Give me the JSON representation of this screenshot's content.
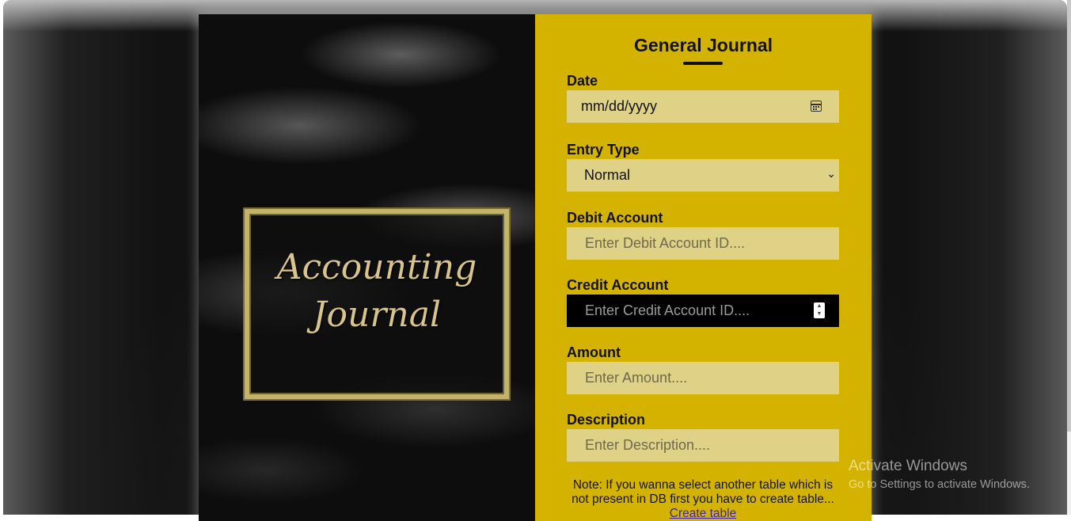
{
  "form": {
    "title": "General Journal",
    "date": {
      "label": "Date",
      "placeholder": "mm/dd/yyyy"
    },
    "entry_type": {
      "label": "Entry Type",
      "selected": "Normal"
    },
    "debit_account": {
      "label": "Debit Account",
      "placeholder": "Enter Debit Account ID...."
    },
    "credit_account": {
      "label": "Credit Account",
      "placeholder": "Enter Credit Account ID...."
    },
    "amount": {
      "label": "Amount",
      "placeholder": "Enter Amount...."
    },
    "description": {
      "label": "Description",
      "placeholder": "Enter Description...."
    },
    "note": {
      "text": "Note: If you wanna select another table which is not present in DB first you have to create table...",
      "link": "Create table"
    }
  },
  "cover": {
    "line1": "Accounting",
    "line2": "Journal"
  },
  "watermark": {
    "title": "Activate Windows",
    "subtitle": "Go to Settings to activate Windows."
  },
  "colors": {
    "panel": "#d4b300",
    "field": "#dfd185",
    "focused_field": "#000000",
    "link": "#3d24a8"
  }
}
